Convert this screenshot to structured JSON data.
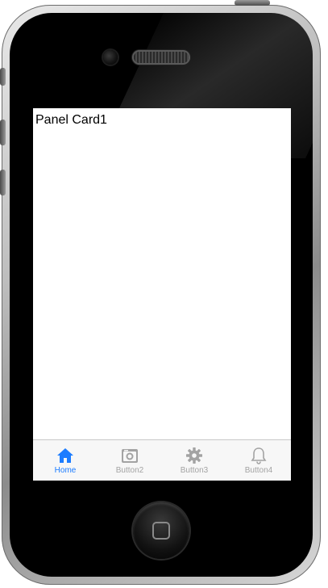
{
  "screen": {
    "panel_title": "Panel Card1"
  },
  "tabs": [
    {
      "label": "Home",
      "icon": "home-icon",
      "active": true
    },
    {
      "label": "Button2",
      "icon": "camera-icon",
      "active": false
    },
    {
      "label": "Button3",
      "icon": "gear-icon",
      "active": false
    },
    {
      "label": "Button4",
      "icon": "bell-icon",
      "active": false
    }
  ],
  "colors": {
    "active_tab": "#1c7cff",
    "inactive_tab": "#a3a3a3",
    "tab_bar_bg": "#f7f7f7"
  }
}
